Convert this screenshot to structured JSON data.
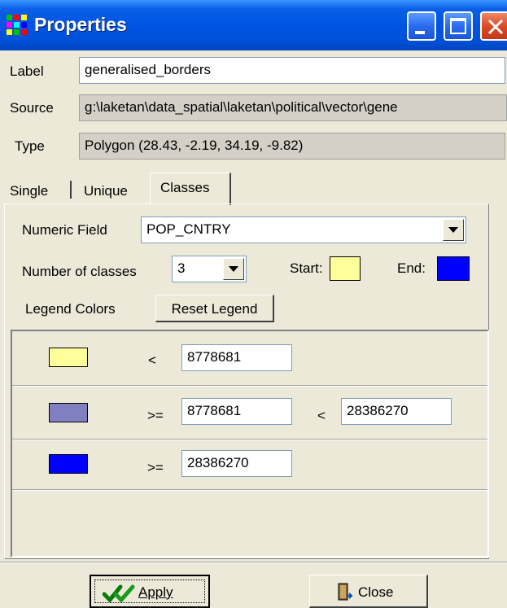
{
  "window": {
    "title": "Properties",
    "colors": {
      "titlebar": "#0054e3",
      "close": "#dc4a26"
    }
  },
  "fields": {
    "label_caption": "Label",
    "label_value": "generalised_borders",
    "source_caption": "Source",
    "source_value": "g:\\laketan\\data_spatial\\laketan\\political\\vector\\gene",
    "type_caption": "Type",
    "type_value": "Polygon  (28.43, -2.19, 34.19, -9.82)"
  },
  "tabs": [
    {
      "label": "Single",
      "active": false
    },
    {
      "label": "Unique",
      "active": false
    },
    {
      "label": "Classes",
      "active": true
    }
  ],
  "classes_panel": {
    "numeric_field_label": "Numeric Field",
    "numeric_field_value": "POP_CNTRY",
    "num_classes_label": "Number of classes",
    "num_classes_value": "3",
    "start_label": "Start:",
    "start_color": "#ffff99",
    "end_label": "End:",
    "end_color": "#0000ff",
    "legend_colors_label": "Legend Colors",
    "reset_legend_label": "Reset Legend",
    "rows": [
      {
        "color": "#ffff99",
        "op1": "<",
        "val1": "8778681",
        "op2": "",
        "val2": ""
      },
      {
        "color": "#8080c0",
        "op1": ">=",
        "val1": "8778681",
        "op2": "<",
        "val2": "28386270"
      },
      {
        "color": "#0000ff",
        "op1": ">=",
        "val1": "28386270",
        "op2": "",
        "val2": ""
      }
    ]
  },
  "buttons": {
    "apply_label": "Apply",
    "close_label": "Close"
  },
  "icons": {
    "app": "colored-grid-icon",
    "apply": "double-checkmark-icon",
    "close": "door-exit-icon",
    "minimize": "minimize-icon",
    "maximize": "maximize-icon",
    "close_window": "close-icon"
  }
}
